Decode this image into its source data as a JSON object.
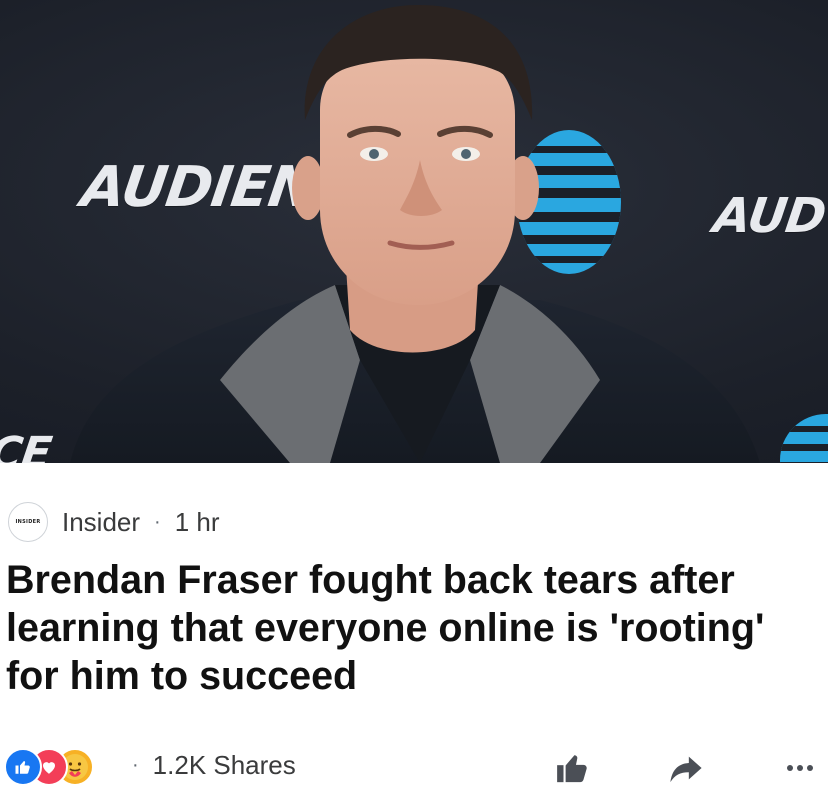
{
  "photo": {
    "backdrop_left": "AUDIEN",
    "backdrop_right": "AUD",
    "backdrop_bottom": "CE"
  },
  "post": {
    "source_logo_text": "INSIDER",
    "source_name": "Insider",
    "separator": "·",
    "time": "1 hr",
    "headline": "Brendan Fraser fought back tears after learning that everyone online is 'rooting' for him to succeed",
    "shares_separator": "·",
    "shares": "1.2K Shares"
  },
  "reactions": [
    "like-reaction-icon",
    "love-reaction-icon",
    "care-reaction-icon"
  ],
  "colors": {
    "like_blue": "#1877f2",
    "love_red": "#f33e58",
    "care_yellow": "#f7b125",
    "att_blue": "#2aa7e0"
  }
}
